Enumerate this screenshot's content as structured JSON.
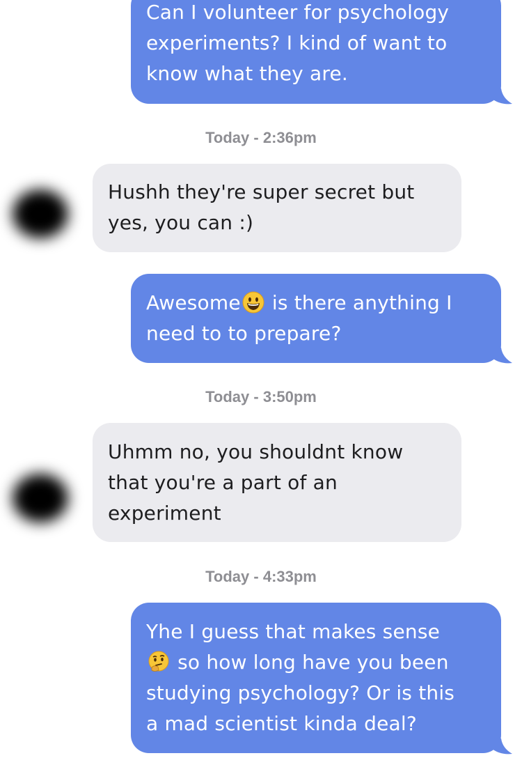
{
  "messages": [
    {
      "direction": "sent",
      "lines": [
        "Can I volunteer for psychology",
        "experiments? I kind of want to",
        "know what they are."
      ]
    },
    {
      "direction": "timestamp",
      "text": "Today - 2:36pm"
    },
    {
      "direction": "received",
      "lines": [
        "Hushh they're super secret but",
        "yes, you can :)"
      ]
    },
    {
      "direction": "sent",
      "line1_before_emoji": "Awesome",
      "emoji": "grinning-face",
      "line1_after_emoji": " is there anything I",
      "line2": "need to to prepare?"
    },
    {
      "direction": "timestamp",
      "text": "Today - 3:50pm"
    },
    {
      "direction": "received",
      "lines": [
        "Uhmm no, you shouldnt know",
        "that you're a part of an",
        "experiment"
      ]
    },
    {
      "direction": "timestamp",
      "text": "Today - 4:33pm"
    },
    {
      "direction": "sent",
      "line1": "Yhe I guess that makes sense",
      "emoji": "thinking-face",
      "line2_after_emoji": " so how long have you been",
      "line3": "studying psychology? Or is this",
      "line4": "a mad scientist kinda deal?"
    }
  ],
  "colors": {
    "sent_bubble": "#6286e6",
    "received_bubble": "#ebebef",
    "timestamp_text": "#8e8e93"
  }
}
